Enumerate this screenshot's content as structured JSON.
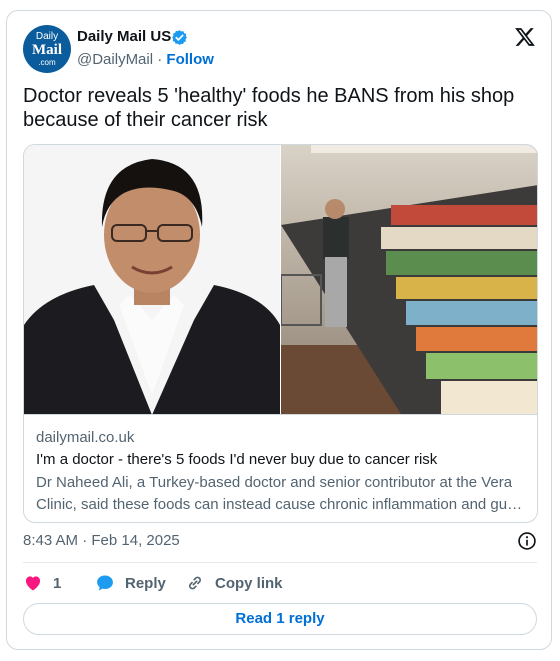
{
  "author": {
    "avatar_line1": "Daily",
    "avatar_line2": "Mail",
    "avatar_line3": ".com",
    "name": "Daily Mail US",
    "handle": "@DailyMail",
    "separator": "·",
    "follow_label": "Follow"
  },
  "tweet": {
    "text": "Doctor reveals 5 'healthy' foods he BANS from his shop because of their cancer risk"
  },
  "link_card": {
    "domain": "dailymail.co.uk",
    "title": "I'm a doctor - there's 5 foods I'd never buy due to cancer risk",
    "description": "Dr Naheed Ali, a Turkey-based doctor and senior contributor at the Vera Clinic, said these foods can instead cause chronic inflammation and gu…"
  },
  "meta": {
    "timestamp": "8:43 AM · Feb 14, 2025"
  },
  "actions": {
    "like_count": "1",
    "reply_label": "Reply",
    "copy_link_label": "Copy link",
    "read_replies_label": "Read 1 reply"
  },
  "colors": {
    "accent": "#006fd6",
    "like": "#f91880",
    "verified": "#1d9bf0",
    "avatar_bg": "#0b5c9c"
  },
  "icons": [
    "verified-badge-icon",
    "x-logo-icon",
    "info-icon",
    "heart-icon",
    "reply-bubble-icon",
    "link-icon"
  ]
}
